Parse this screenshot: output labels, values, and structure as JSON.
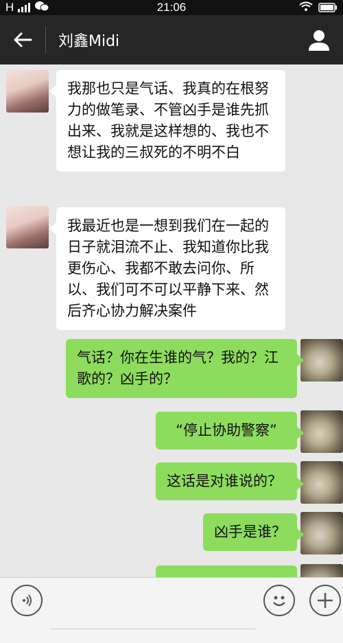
{
  "status": {
    "carrier": "H",
    "time": "21:06"
  },
  "header": {
    "title": "刘鑫Midi",
    "back_icon": "back-arrow-icon",
    "profile_icon": "person-icon"
  },
  "messages": [
    {
      "side": "left",
      "text": "我那也只是气话、我真的在根努力的做笔录、不管凶手是谁先抓出来、我就是这样想的、我也不想让我的三叔死的不明不白"
    },
    {
      "side": "left",
      "text": "我最近也是一想到我们在一起的日子就泪流不止、我知道你比我更伤心、我都不敢去问你、所以、我们可不可以平静下来、然后齐心协力解决案件"
    },
    {
      "side": "right",
      "text": "气话？你在生谁的气？我的？江歌的？凶手的？"
    },
    {
      "side": "right",
      "text": "“停止协助警察”"
    },
    {
      "side": "right",
      "text": "这话是对谁说的？"
    },
    {
      "side": "right",
      "text": "凶手是谁？"
    },
    {
      "side": "right",
      "text": ""
    }
  ],
  "input_bar": {
    "voice_icon": "voice-icon",
    "emoji_icon": "emoji-icon",
    "add_icon": "plus-icon"
  },
  "colors": {
    "header_bg": "#262626",
    "chat_bg": "#e8e8e8",
    "sent_bubble": "#8edc5e",
    "received_bubble": "#ffffff"
  }
}
